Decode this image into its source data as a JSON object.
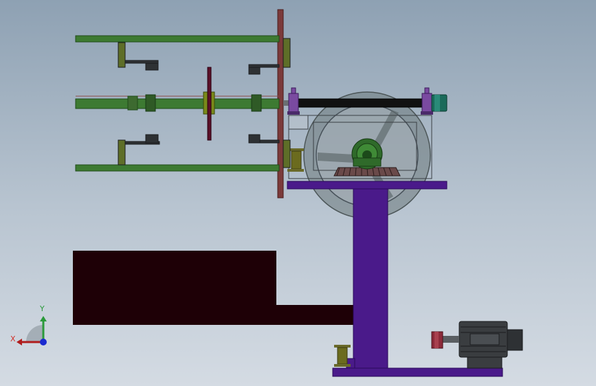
{
  "viewport": {
    "background_top": "#8ea1b3",
    "background_bottom": "#d4dbe3"
  },
  "model": {
    "parts": [
      "conveyor-frame",
      "vertical-plate",
      "transfer-shaft",
      "large-handwheel",
      "bevel-gear-set",
      "support-column",
      "base-plate",
      "electric-motor",
      "coupling",
      "bearing-housings",
      "dark-block"
    ],
    "colors": {
      "frame_green": "#3d7a32",
      "plate_brown": "#7b3a3a",
      "column_purple": "#4a1a8a",
      "block_dark": "#1e0006",
      "wheel_grey": "#6e7a7c",
      "motor_grey": "#3a3d40",
      "bearing_purple": "#7a4aa0",
      "coupling_red": "#8c2a3a"
    }
  },
  "triad": {
    "x_label": "X",
    "y_label": "Y",
    "x_color": "#d0302a",
    "y_color": "#2a9a3a",
    "z_color": "#1a2ad0"
  }
}
